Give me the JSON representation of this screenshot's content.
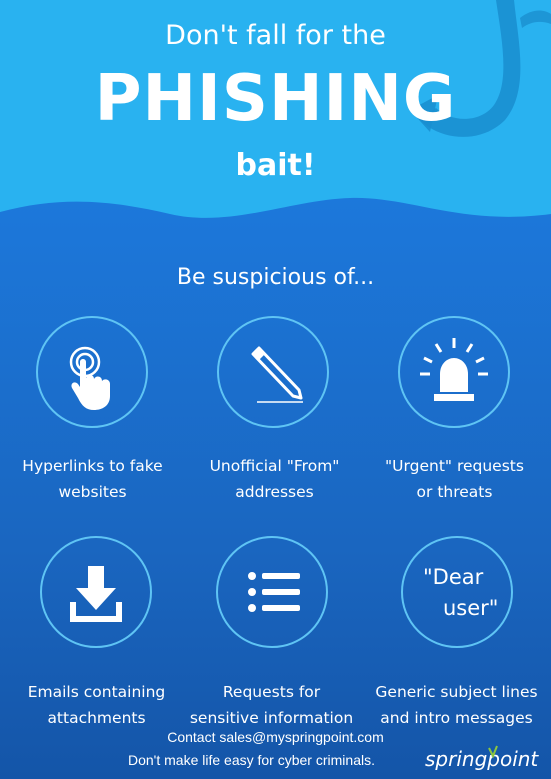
{
  "title": {
    "line1": "Don't fall for the",
    "line2": "PHISHING",
    "line3": "bait!"
  },
  "subheading": "Be suspicious of...",
  "items": [
    {
      "label_line1": "Hyperlinks to fake",
      "label_line2": "websites",
      "icon": "pointing-hand-icon"
    },
    {
      "label_line1": "Unofficial \"From\"",
      "label_line2": "addresses",
      "icon": "pen-icon"
    },
    {
      "label_line1": "\"Urgent\" requests",
      "label_line2": "or threats",
      "icon": "alarm-light-icon"
    },
    {
      "label_line1": "Emails containing",
      "label_line2": "attachments",
      "icon": "download-icon"
    },
    {
      "label_line1": "Requests for",
      "label_line2": "sensitive information",
      "icon": "list-icon"
    },
    {
      "label_line1": "Generic subject lines",
      "label_line2": "and intro messages",
      "icon": "quote",
      "quote_line1": "\"Dear",
      "quote_line2": "user\""
    }
  ],
  "footer": {
    "contact": "Contact sales@myspringpoint.com",
    "tagline": "Don't make life easy for cyber criminals.",
    "logo_text": "springpoint"
  },
  "colors": {
    "sky": "#29b2f0",
    "sea_top": "#1c78db",
    "sea_bottom": "#1455a8",
    "circle_border": "#5fc4f4",
    "hook": "#1a8fd0",
    "logo_accent": "#8cc63f"
  }
}
